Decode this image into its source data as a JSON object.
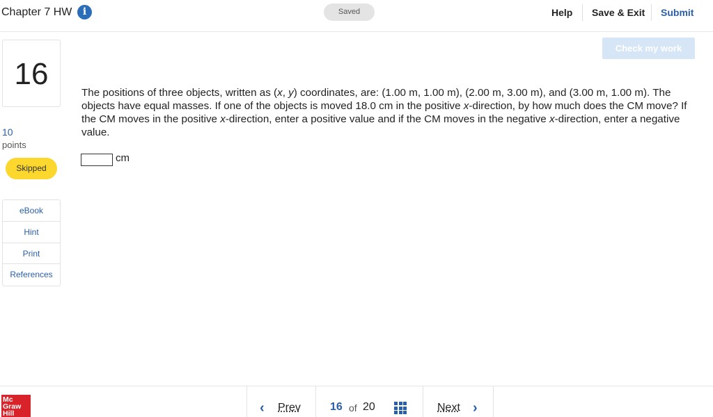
{
  "header": {
    "title": "Chapter 7 HW",
    "info_icon": "info-icon",
    "saved": "Saved",
    "help": "Help",
    "save_exit": "Save & Exit",
    "submit": "Submit"
  },
  "question_panel": {
    "number": "16",
    "points_value": "10",
    "points_label": "points",
    "status": "Skipped",
    "resources": [
      "eBook",
      "Hint",
      "Print",
      "References"
    ]
  },
  "main": {
    "check_button": "Check my work",
    "question_part1": "The positions of three objects, written as (",
    "x_var": "x",
    "comma": ", ",
    "y_var": "y",
    "question_part2": ") coordinates, are: (1.00 m, 1.00 m), (2.00 m, 3.00 m), and (3.00 m, 1.00 m). The objects have equal masses. If one of the objects is moved 18.0 cm in the positive ",
    "x_var2": "x",
    "question_part3": "-direction, by how much does the CM move? If the CM moves in the positive ",
    "x_var3": "x",
    "question_part4": "-direction, enter a positive value and if the CM moves in the negative ",
    "x_var4": "x",
    "question_part5": "-direction, enter a negative value.",
    "answer_value": "",
    "unit": "cm"
  },
  "footer": {
    "logo_line1": "Mc",
    "logo_line2": "Graw",
    "logo_line3": "Hill",
    "prev": "Prev",
    "current": "16",
    "of": "of",
    "total": "20",
    "next": "Next"
  },
  "colors": {
    "accent": "#2a5ea8",
    "skipped_badge": "#fcd72d",
    "logo_red": "#d8232a"
  }
}
